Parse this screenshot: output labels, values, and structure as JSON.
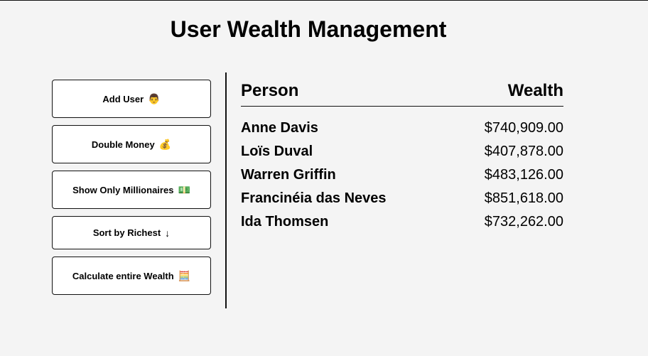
{
  "header": {
    "title": "User Wealth Management"
  },
  "sidebar": {
    "buttons": [
      {
        "label": "Add User",
        "emoji": "👨"
      },
      {
        "label": "Double Money",
        "emoji": "💰"
      },
      {
        "label": "Show Only Millionaires",
        "emoji": "💵"
      },
      {
        "label": "Sort by Richest",
        "emoji": "↓"
      },
      {
        "label": "Calculate entire Wealth",
        "emoji": "🧮"
      }
    ]
  },
  "table": {
    "headers": {
      "person": "Person",
      "wealth": "Wealth"
    },
    "rows": [
      {
        "name": "Anne Davis",
        "wealth": "$740,909.00"
      },
      {
        "name": "Loïs Duval",
        "wealth": "$407,878.00"
      },
      {
        "name": "Warren Griffin",
        "wealth": "$483,126.00"
      },
      {
        "name": "Francinéia das Neves",
        "wealth": "$851,618.00"
      },
      {
        "name": "Ida Thomsen",
        "wealth": "$732,262.00"
      }
    ]
  }
}
